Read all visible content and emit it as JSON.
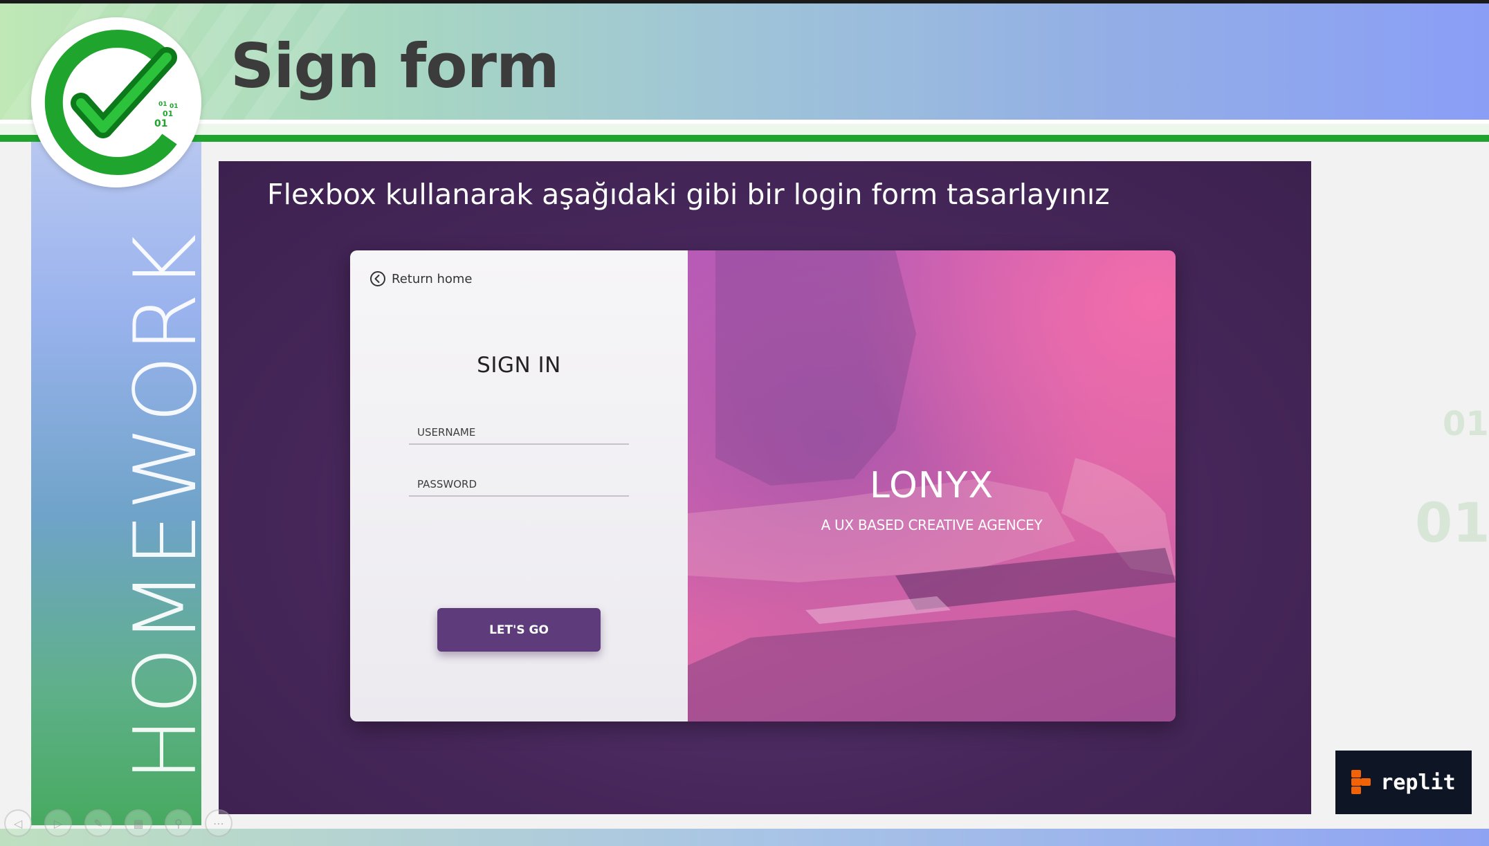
{
  "slide": {
    "title": "Sign form",
    "side_label": "HOMEWORK",
    "instruction": "Flexbox kullanarak aşağıdaki gibi bir login form tasarlayınız",
    "logo_digits": [
      "01",
      "01",
      "01",
      "01"
    ]
  },
  "mockup": {
    "return_home": "Return home",
    "signin_title": "SIGN IN",
    "username_placeholder": "USERNAME",
    "password_placeholder": "PASSWORD",
    "submit_label": "LET'S GO",
    "brand_name": "LONYX",
    "brand_tagline": "A UX BASED CREATIVE AGENCEY"
  },
  "badge": {
    "label": "replit",
    "logo_color": "#f26207"
  },
  "colors": {
    "accent_green": "#1fa52e",
    "panel_purple": "#462659",
    "button_purple": "#5e3c7c",
    "title_text": "#3c3c3c"
  },
  "nav": {
    "icons": [
      "prev-icon",
      "next-icon",
      "pen-icon",
      "slides-icon",
      "zoom-icon",
      "more-icon"
    ]
  }
}
